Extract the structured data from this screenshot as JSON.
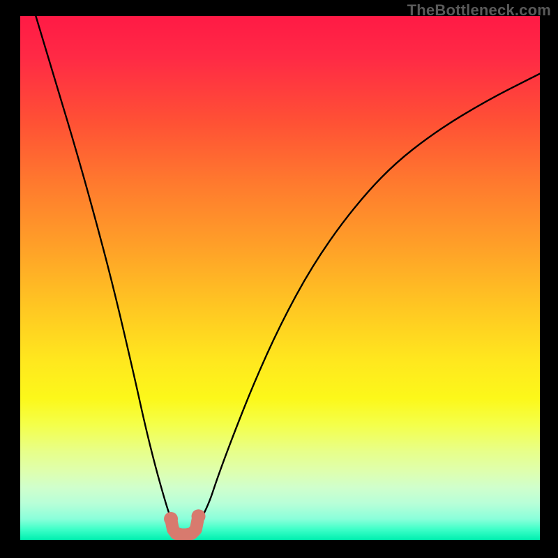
{
  "watermark": "TheBottleneck.com",
  "chart_data": {
    "type": "line",
    "title": "",
    "xlabel": "",
    "ylabel": "",
    "xlim": [
      0,
      100
    ],
    "ylim": [
      0,
      100
    ],
    "grid": false,
    "legend": false,
    "series": [
      {
        "name": "left-curve",
        "x": [
          3,
          6,
          10,
          14,
          18,
          22,
          24,
          26,
          28,
          29,
          30
        ],
        "y": [
          100,
          90,
          77,
          63,
          48,
          31,
          22,
          14,
          7,
          4,
          2.5
        ]
      },
      {
        "name": "right-curve",
        "x": [
          34,
          36,
          38,
          41,
          45,
          50,
          56,
          63,
          71,
          80,
          90,
          100
        ],
        "y": [
          2.5,
          6,
          12,
          20,
          30,
          41,
          52,
          62,
          71,
          78,
          84,
          89
        ]
      }
    ],
    "marker": {
      "name": "u-shape-marker",
      "color": "#d87a6e",
      "points_x": [
        29.0,
        29.4,
        30.0,
        31.0,
        32.0,
        33.0,
        33.8,
        34.3
      ],
      "points_y": [
        4.0,
        2.0,
        1.2,
        1.0,
        1.0,
        1.2,
        2.0,
        4.5
      ]
    },
    "background_gradient": {
      "top": "#ff1a45",
      "mid_upper": "#ff7a2e",
      "mid": "#ffe81e",
      "mid_lower": "#d0ffcc",
      "bottom": "#00f0b0"
    }
  }
}
